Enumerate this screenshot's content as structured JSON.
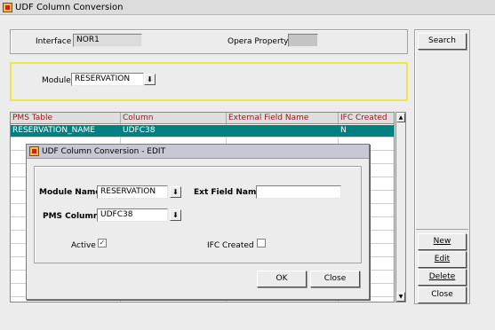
{
  "window": {
    "title": "UDF Column Conversion"
  },
  "filter": {
    "interface_label": "Interface",
    "interface_value": "NOR1",
    "property_label": "Opera Property",
    "property_value": "",
    "module_label": "Module",
    "module_value": "RESERVATION"
  },
  "grid": {
    "columns": [
      "PMS Table",
      "Column",
      "External Field Name",
      "IFC Created"
    ],
    "rows": [
      [
        "RESERVATION_NAME",
        "UDFC38",
        "",
        "N"
      ]
    ],
    "selected_color": "#008080"
  },
  "side_buttons": {
    "search": "Search",
    "new": "New",
    "edit": "Edit",
    "delete": "Delete",
    "close": "Close"
  },
  "dialog": {
    "title": "UDF Column Conversion - EDIT",
    "module_name_label": "Module Name",
    "module_name_value": "RESERVATION",
    "ext_field_label": "Ext Field Name",
    "ext_field_value": "",
    "pms_column_label": "PMS Column",
    "pms_column_value": "UDFC38",
    "active_label": "Active",
    "active_checked": true,
    "ifc_created_label": "IFC Created",
    "ifc_created_checked": false,
    "ok": "OK",
    "close": "Close"
  }
}
